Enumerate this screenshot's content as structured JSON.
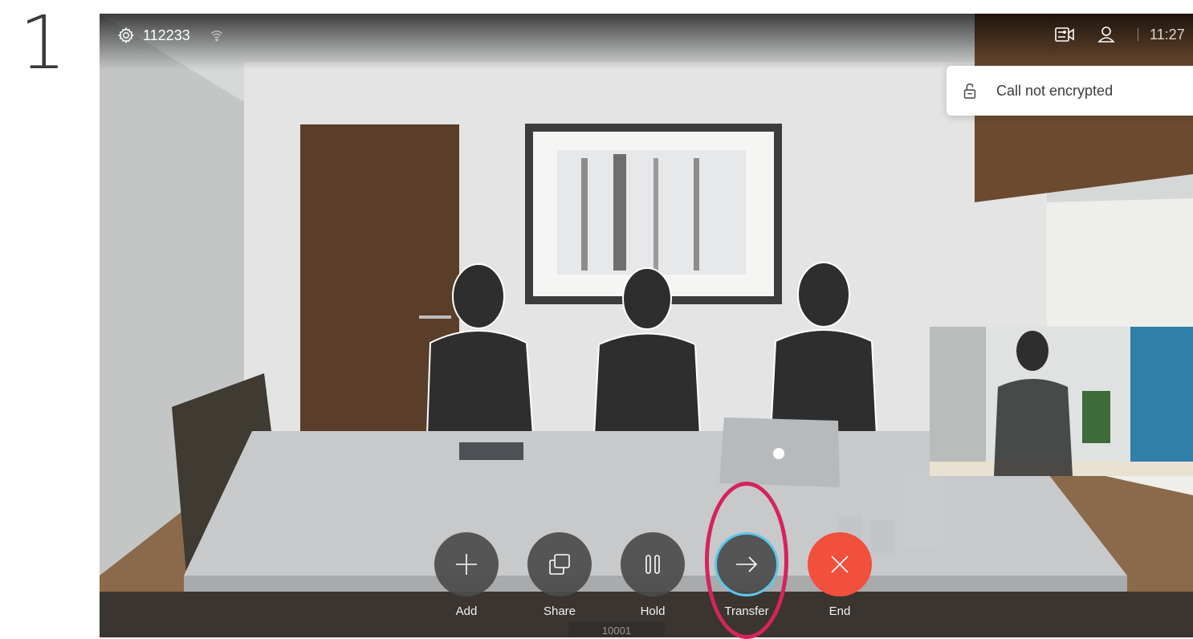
{
  "step": {
    "number": "1"
  },
  "topbar": {
    "system_number": "112233",
    "time": "11:27"
  },
  "notification": {
    "text": "Call not encrypted"
  },
  "call_controls": [
    {
      "label": "Add"
    },
    {
      "label": "Share"
    },
    {
      "label": "Hold"
    },
    {
      "label": "Transfer"
    },
    {
      "label": "End"
    }
  ],
  "call_number": "10001",
  "colors": {
    "end_button": "#f0503c",
    "transfer_ring": "#5cc7ea",
    "highlight": "#d4245b"
  }
}
